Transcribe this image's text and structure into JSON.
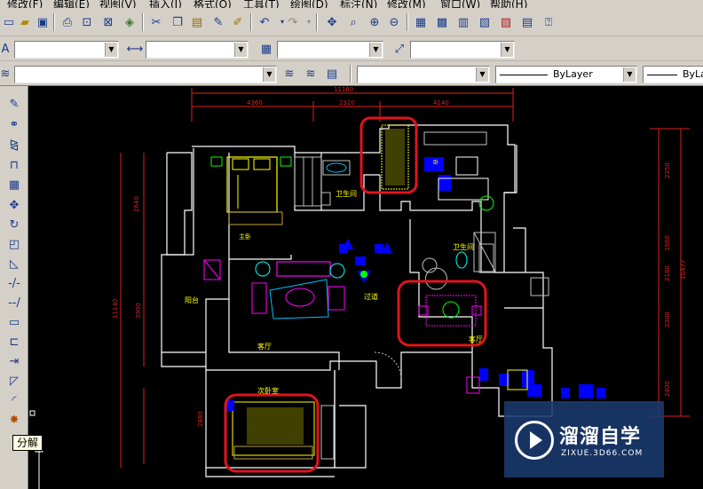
{
  "menu": {
    "items": [
      "修改(F)",
      "编辑(E)",
      "视图(V)",
      "插入(I)",
      "格式(O)",
      "工具(T)",
      "绘图(D)",
      "标注(N)",
      "修改(M)",
      "窗口(W)",
      "帮助(H)"
    ]
  },
  "icons": {
    "standard": [
      "new-icon",
      "open-icon",
      "save-icon",
      "print-icon",
      "print-preview-icon",
      "publish-icon",
      "3d-dwf-icon",
      "cut-icon",
      "copy-icon",
      "paste-icon",
      "match-properties-icon",
      "block-editor-icon",
      "undo-icon",
      "redo-icon",
      "pan-icon",
      "zoom-realtime-icon",
      "zoom-window-icon",
      "zoom-previous-icon",
      "properties-icon",
      "design-center-icon",
      "tool-palettes-icon",
      "sheet-set-icon",
      "markup-icon",
      "quickcalc-icon",
      "help-icon"
    ],
    "modify": [
      "erase-icon",
      "copy-object-icon",
      "mirror-icon",
      "offset-icon",
      "array-icon",
      "move-icon",
      "rotate-icon",
      "scale-icon",
      "stretch-icon",
      "trim-icon",
      "extend-icon",
      "break-at-point-icon",
      "break-icon",
      "join-icon",
      "chamfer-icon",
      "fillet-icon",
      "explode-icon"
    ]
  },
  "styles_toolbar": {
    "text_style": "",
    "dim_style": "",
    "table_style": "",
    "multileader_style": ""
  },
  "layers_toolbar": {
    "layer": "",
    "color": "",
    "linetype": "ByLayer",
    "lineweight": "ByLa"
  },
  "tooltip": "分解",
  "drawing": {
    "dimensions": {
      "overall_width": "11160",
      "segment_1": "4360",
      "segment_2": "2320",
      "segment_3": "4140",
      "left_upper": "2640",
      "left_total": "11140",
      "left_mid": "3900",
      "left_lower": "2880",
      "right_total": "15477",
      "right_1": "2250",
      "right_2": "1500",
      "right_3": "2100",
      "right_4": "2300",
      "right_5": "2400"
    },
    "room_labels": {
      "bathroom_1": "卫生间",
      "bathroom_2": "卫生间",
      "balcony": "阳台",
      "living_room": "客厅",
      "corridor": "过道",
      "dining": "客厅",
      "second_bedroom": "次卧室",
      "master": "主卧"
    },
    "highlight_color": "#e0141c",
    "wall_color": "#ffffff",
    "dim_color": "#e02020"
  },
  "watermark": {
    "title": "溜溜自学",
    "url": "ZIXUE.3D66.COM"
  }
}
